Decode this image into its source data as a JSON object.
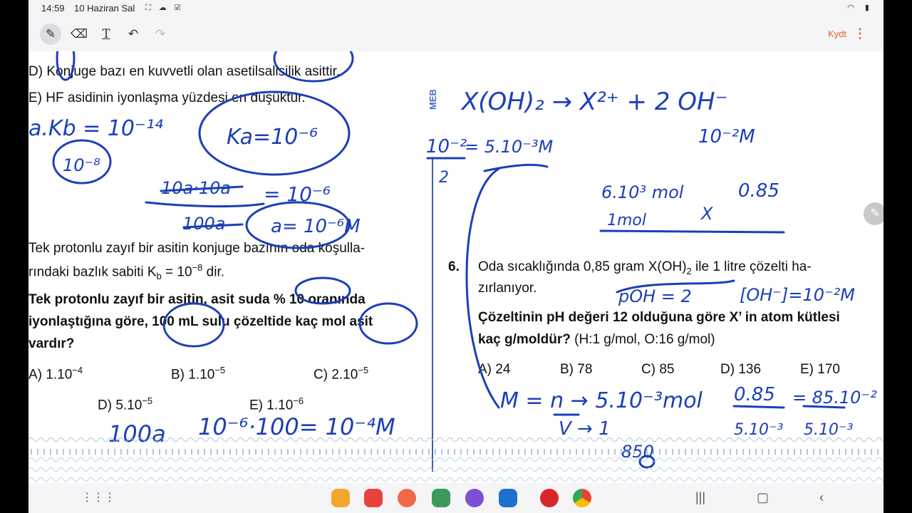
{
  "status": {
    "time": "14:59",
    "date": "10 Haziran Sal"
  },
  "toolbar": {
    "save_label": "Kydt"
  },
  "left": {
    "opt_d": "D) Konjuge bazı en kuvvetli olan asetilsalisilik asittir.",
    "opt_e": "E) HF asidinin iyonlaşma yüzdesi en düşüktür.",
    "intro1": "Tek protonlu zayıf bir asitin konjuge bazının oda koşulla-",
    "intro2_pre": "rındaki bazlık sabiti K",
    "intro2_sub": "b",
    "intro2_mid": " = 10",
    "intro2_sup": "−8",
    "intro2_post": " dir.",
    "q1": "Tek protonlu zayıf bir asitin, asit suda % 10 oranında",
    "q2": "iyonlaştığına göre, 100 mL sulu çözeltide kaç mol asit",
    "q3": "vardır?",
    "answers": [
      {
        "base": "A) 1.10",
        "exp": "−4"
      },
      {
        "base": "B) 1.10",
        "exp": "−5"
      },
      {
        "base": "C) 2.10",
        "exp": "−5"
      },
      {
        "base": "D) 5.10",
        "exp": "−5"
      },
      {
        "base": "E) 1.10",
        "exp": "−6"
      }
    ]
  },
  "right": {
    "meb": "MEB",
    "qnum": "6.",
    "line1_pre": "Oda sıcaklığında 0,85 gram X(OH)",
    "line1_sub": "2",
    "line1_post": " ile 1 litre çözelti ha-",
    "line2": "zırlanıyor.",
    "q1": "Çözeltinin pH değeri 12 olduğuna göre X’ in atom kütlesi",
    "q2_bold": "kaç g/moldür?",
    "q2_rest": " (H:1 g/mol, O:16 g/mol)",
    "answers": [
      "A) 24",
      "B) 78",
      "C) 85",
      "D) 136",
      "E) 170"
    ]
  },
  "handwriting": {
    "left": [
      "a.Kb = 10⁻¹⁴",
      "10⁻⁸",
      "Ka=10⁻⁶",
      "10a·10a",
      "100a",
      "= 10⁻⁶",
      "a= 10⁻⁶M",
      "100a",
      "10⁻⁶·100= 10⁻⁴M"
    ],
    "right": [
      "X(OH)₂ → X²⁺ + 2 OH⁻",
      "10⁻²",
      "= 5.10⁻³M",
      "2",
      "10⁻²M",
      "6.10³ mol",
      "0.85",
      "1mol",
      "X",
      "pOH = 2",
      "[OH⁻]=10⁻²M",
      "M = n → 5.10⁻³mol",
      "V → 1",
      "0.85",
      "5.10⁻³",
      "= 85.10⁻²",
      "5.10⁻³",
      "850"
    ]
  },
  "colors": {
    "ink": "#1c3fb8",
    "accent": "#e0602e"
  }
}
